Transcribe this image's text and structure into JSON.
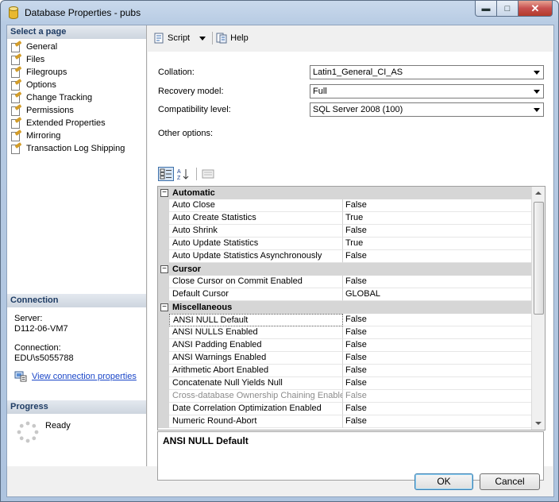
{
  "window": {
    "title": "Database Properties - pubs"
  },
  "select_page": {
    "header": "Select a page",
    "items": [
      "General",
      "Files",
      "Filegroups",
      "Options",
      "Change Tracking",
      "Permissions",
      "Extended Properties",
      "Mirroring",
      "Transaction Log Shipping"
    ]
  },
  "connection": {
    "header": "Connection",
    "server_label": "Server:",
    "server_value": "D112-06-VM7",
    "connection_label": "Connection:",
    "connection_value": "EDU\\s5055788",
    "view_link": "View connection properties"
  },
  "progress": {
    "header": "Progress",
    "status": "Ready"
  },
  "toolbar": {
    "script_label": "Script",
    "help_label": "Help"
  },
  "form": {
    "collation_label": "Collation:",
    "collation_value": "Latin1_General_CI_AS",
    "recovery_label": "Recovery model:",
    "recovery_value": "Full",
    "compat_label": "Compatibility level:",
    "compat_value": "SQL Server 2008 (100)",
    "other_label": "Other options:"
  },
  "grid": {
    "categories": [
      {
        "name": "Automatic",
        "rows": [
          [
            "Auto Close",
            "False"
          ],
          [
            "Auto Create Statistics",
            "True"
          ],
          [
            "Auto Shrink",
            "False"
          ],
          [
            "Auto Update Statistics",
            "True"
          ],
          [
            "Auto Update Statistics Asynchronously",
            "False"
          ]
        ]
      },
      {
        "name": "Cursor",
        "rows": [
          [
            "Close Cursor on Commit Enabled",
            "False"
          ],
          [
            "Default Cursor",
            "GLOBAL"
          ]
        ]
      },
      {
        "name": "Miscellaneous",
        "rows": [
          [
            "ANSI NULL Default",
            "False"
          ],
          [
            "ANSI NULLS Enabled",
            "False"
          ],
          [
            "ANSI Padding Enabled",
            "False"
          ],
          [
            "ANSI Warnings Enabled",
            "False"
          ],
          [
            "Arithmetic Abort Enabled",
            "False"
          ],
          [
            "Concatenate Null Yields Null",
            "False"
          ],
          [
            "Cross-database Ownership Chaining Enabled",
            "False"
          ],
          [
            "Date Correlation Optimization Enabled",
            "False"
          ],
          [
            "Numeric Round-Abort",
            "False"
          ]
        ]
      }
    ],
    "disabled_row": "Cross-database Ownership Chaining Enabled",
    "selected_row": "ANSI NULL Default"
  },
  "description": {
    "title": "ANSI NULL Default"
  },
  "buttons": {
    "ok": "OK",
    "cancel": "Cancel"
  }
}
